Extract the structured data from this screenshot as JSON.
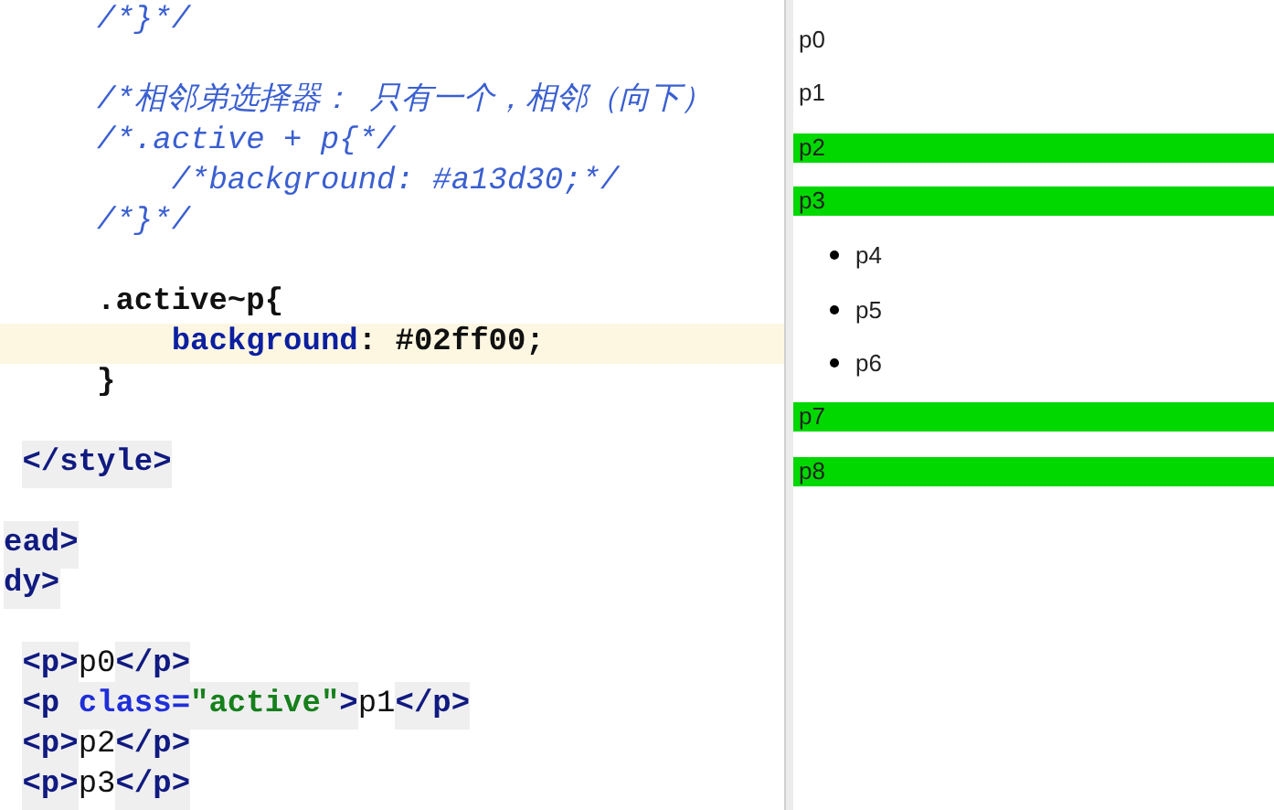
{
  "editor": {
    "lines": [
      {
        "kind": "code",
        "tokens": [
          {
            "kind": "comment",
            "text": "     /*}*/"
          }
        ]
      },
      {
        "kind": "blank"
      },
      {
        "kind": "code",
        "tokens": [
          {
            "kind": "comment",
            "text": "     /*相邻弟选择器： 只有一个，相邻（向下）"
          }
        ]
      },
      {
        "kind": "code",
        "tokens": [
          {
            "kind": "comment",
            "text": "     /*.active + p{*/"
          }
        ]
      },
      {
        "kind": "code",
        "tokens": [
          {
            "kind": "comment",
            "text": "         /*background: #a13d30;*/"
          }
        ]
      },
      {
        "kind": "code",
        "tokens": [
          {
            "kind": "comment",
            "text": "     /*}*/"
          }
        ]
      },
      {
        "kind": "blank"
      },
      {
        "kind": "code",
        "tokens": [
          {
            "kind": "selector",
            "text": "     .active~p{"
          }
        ]
      },
      {
        "kind": "code",
        "current": true,
        "tokens": [
          {
            "kind": "property",
            "text": "         background"
          },
          {
            "kind": "punct",
            "text": ": "
          },
          {
            "kind": "value",
            "text": "#02ff00;"
          }
        ]
      },
      {
        "kind": "code",
        "tokens": [
          {
            "kind": "selector",
            "text": "     }"
          }
        ]
      },
      {
        "kind": "blank"
      },
      {
        "kind": "code",
        "tokens": [
          {
            "kind": "tag",
            "text": " </style>"
          }
        ]
      },
      {
        "kind": "blank"
      },
      {
        "kind": "code",
        "tokens": [
          {
            "kind": "tag",
            "text": "ead>"
          }
        ]
      },
      {
        "kind": "code",
        "tokens": [
          {
            "kind": "tag",
            "text": "dy>"
          }
        ]
      },
      {
        "kind": "blank"
      },
      {
        "kind": "code",
        "tokens": [
          {
            "kind": "tag",
            "text": " <p>"
          },
          {
            "kind": "text",
            "text": "p0"
          },
          {
            "kind": "tag",
            "text": "</p>"
          }
        ]
      },
      {
        "kind": "code",
        "tokens": [
          {
            "kind": "tag",
            "text": " <p "
          },
          {
            "kind": "attr",
            "text": "class="
          },
          {
            "kind": "string",
            "text": "\"active\""
          },
          {
            "kind": "tag",
            "text": ">"
          },
          {
            "kind": "text",
            "text": "p1"
          },
          {
            "kind": "tag",
            "text": "</p>"
          }
        ]
      },
      {
        "kind": "code",
        "tokens": [
          {
            "kind": "tag",
            "text": " <p>"
          },
          {
            "kind": "text",
            "text": "p2"
          },
          {
            "kind": "tag",
            "text": "</p>"
          }
        ]
      },
      {
        "kind": "code",
        "tokens": [
          {
            "kind": "tag",
            "text": " <p>"
          },
          {
            "kind": "text",
            "text": "p3"
          },
          {
            "kind": "tag",
            "text": "</p>"
          }
        ]
      }
    ]
  },
  "preview": {
    "items": [
      {
        "kind": "paragraph",
        "text": "p0",
        "highlighted": false
      },
      {
        "kind": "paragraph",
        "text": "p1",
        "highlighted": false
      },
      {
        "kind": "paragraph",
        "text": "p2",
        "highlighted": true
      },
      {
        "kind": "paragraph",
        "text": "p3",
        "highlighted": true
      },
      {
        "kind": "bullet",
        "text": "p4",
        "highlighted": false
      },
      {
        "kind": "bullet",
        "text": "p5",
        "highlighted": false
      },
      {
        "kind": "bullet",
        "text": "p6",
        "highlighted": false
      },
      {
        "kind": "paragraph",
        "text": "p7",
        "highlighted": true
      },
      {
        "kind": "paragraph",
        "text": "p8",
        "highlighted": true
      }
    ]
  }
}
